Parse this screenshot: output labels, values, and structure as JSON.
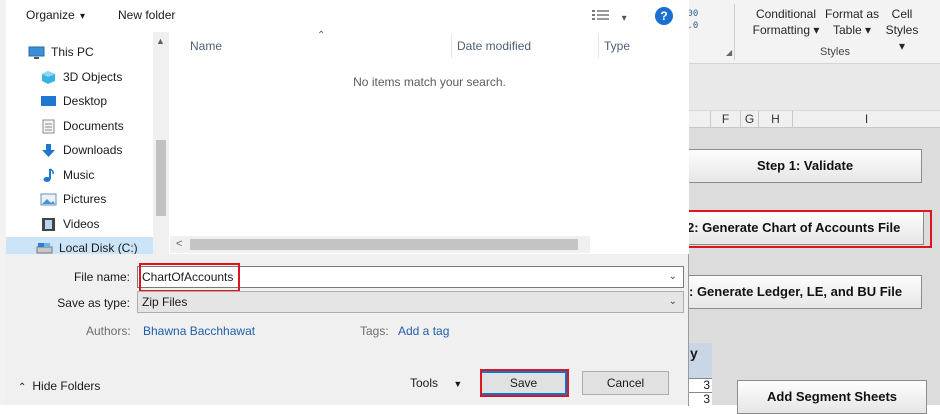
{
  "dialog": {
    "toolbar": {
      "organize": "Organize",
      "organize_caret": "▾",
      "new_folder": "New folder",
      "view_caret": "▾",
      "help": "?"
    },
    "nav": {
      "items": [
        {
          "label": "This PC",
          "icon": "pc-icon"
        },
        {
          "label": "3D Objects",
          "icon": "cube-icon"
        },
        {
          "label": "Desktop",
          "icon": "desktop-icon"
        },
        {
          "label": "Documents",
          "icon": "documents-icon"
        },
        {
          "label": "Downloads",
          "icon": "download-icon"
        },
        {
          "label": "Music",
          "icon": "music-icon"
        },
        {
          "label": "Pictures",
          "icon": "pictures-icon"
        },
        {
          "label": "Videos",
          "icon": "videos-icon"
        },
        {
          "label": "Local Disk (C:)",
          "icon": "disk-icon"
        }
      ]
    },
    "file_list": {
      "columns": [
        "Name",
        "Date modified",
        "Type"
      ],
      "empty_message": "No items match your search."
    },
    "form": {
      "file_name_label": "File name:",
      "file_name_value": "ChartOfAccounts",
      "save_as_type_label": "Save as type:",
      "save_as_type_value": "Zip Files",
      "authors_label": "Authors:",
      "authors_value": "Bhawna Bacchhawat",
      "tags_label": "Tags:",
      "tags_value": "Add a tag"
    },
    "footer": {
      "hide_folders": "Hide Folders",
      "tools": "Tools",
      "save": "Save",
      "cancel": "Cancel"
    }
  },
  "excel": {
    "ribbon": {
      "conditional_formatting": [
        "Conditional",
        "Formatting ▾"
      ],
      "format_as_table": [
        "Format as",
        "Table ▾"
      ],
      "cell_styles": [
        "Cell",
        "Styles ▾"
      ],
      "group_label": "Styles",
      "number_icons": [
        ".00",
        "→.0"
      ]
    },
    "columns": [
      "F",
      "G",
      "H",
      "I"
    ],
    "buttons": {
      "step1": "Step 1: Validate",
      "step2": "2: Generate Chart of Accounts File",
      "step3": ": Generate Ledger, LE, and BU File",
      "add_segment": "Add Segment Sheets"
    },
    "table": {
      "header": "y",
      "values": [
        "3",
        "3"
      ]
    }
  },
  "colors": {
    "highlight_red": "#e0141e",
    "accent_blue": "#0078d7",
    "link_blue": "#1f5fa8"
  }
}
